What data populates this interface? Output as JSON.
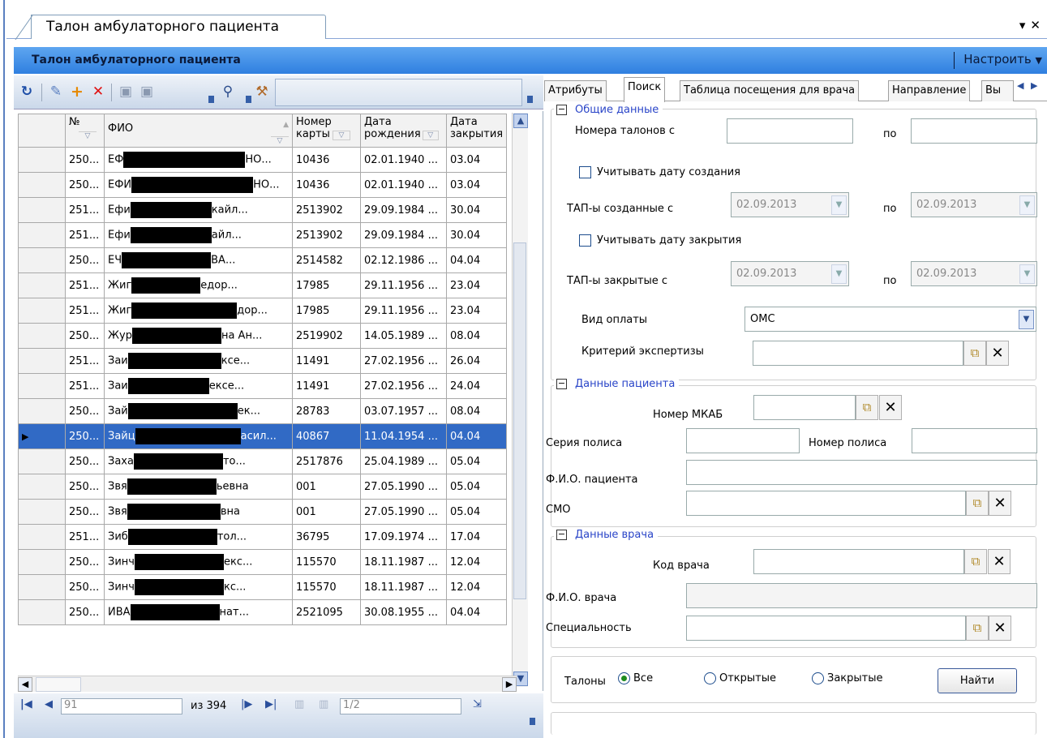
{
  "window": {
    "doc_tab": "Талон амбулаторного пациента",
    "header_title": "Талон амбулаторного пациента",
    "configure_label": "Настроить"
  },
  "toolbar": {
    "icons": [
      "refresh-icon",
      "edit-icon",
      "add-icon",
      "delete-icon",
      "save-icon",
      "save-all-icon",
      "binoculars-icon",
      "tools-icon"
    ]
  },
  "grid": {
    "columns": [
      "№",
      "ФИО",
      "Номер карты",
      "Дата рождения",
      "Дата закрытия"
    ],
    "col_no": "№",
    "col_fio": "ФИО",
    "col_card_1": "Номер",
    "col_card_2": "карты",
    "col_birth_1": "Дата",
    "col_birth_2": "рождения",
    "col_close_1": "Дата",
    "col_close_2": "закрытия",
    "rows": [
      {
        "no": "250...",
        "fio_a": "ЕФ",
        "fio_b": "НО...",
        "card": "10436",
        "birth": "02.01.1940 ...",
        "close": "03.04"
      },
      {
        "no": "250...",
        "fio_a": "ЕФИ",
        "fio_b": "НО...",
        "card": "10436",
        "birth": "02.01.1940 ...",
        "close": "03.04"
      },
      {
        "no": "251...",
        "fio_a": "Ефи",
        "fio_b": "кайл...",
        "card": "2513902",
        "birth": "29.09.1984 ...",
        "close": "30.04"
      },
      {
        "no": "251...",
        "fio_a": "Ефи",
        "fio_b": "айл...",
        "card": "2513902",
        "birth": "29.09.1984 ...",
        "close": "30.04"
      },
      {
        "no": "250...",
        "fio_a": "ЕЧ",
        "fio_b": "ВА...",
        "card": "2514582",
        "birth": "02.12.1986 ...",
        "close": "04.04"
      },
      {
        "no": "251...",
        "fio_a": "Жиг",
        "fio_b": "едор...",
        "card": "17985",
        "birth": "29.11.1956 ...",
        "close": "23.04"
      },
      {
        "no": "251...",
        "fio_a": "Жиг",
        "fio_b": "дор...",
        "card": "17985",
        "birth": "29.11.1956 ...",
        "close": "23.04"
      },
      {
        "no": "250...",
        "fio_a": "Жур",
        "fio_b": "на Ан...",
        "card": "2519902",
        "birth": "14.05.1989 ...",
        "close": "08.04"
      },
      {
        "no": "251...",
        "fio_a": "Заи",
        "fio_b": "ксе...",
        "card": "11491",
        "birth": "27.02.1956 ...",
        "close": "26.04"
      },
      {
        "no": "251...",
        "fio_a": "Заи",
        "fio_b": "ексе...",
        "card": "11491",
        "birth": "27.02.1956 ...",
        "close": "24.04"
      },
      {
        "no": "250...",
        "fio_a": "Зай",
        "fio_b": "ек...",
        "card": "28783",
        "birth": "03.07.1957 ...",
        "close": "08.04"
      },
      {
        "no": "250...",
        "fio_a": "Зайц",
        "fio_b": "асил...",
        "card": "40867",
        "birth": "11.04.1954 ...",
        "close": "04.04",
        "selected": true
      },
      {
        "no": "250...",
        "fio_a": "Заха",
        "fio_b": "то...",
        "card": "2517876",
        "birth": "25.04.1989 ...",
        "close": "05.04"
      },
      {
        "no": "250...",
        "fio_a": "Звя",
        "fio_b": "ьевна",
        "card": "001",
        "birth": "27.05.1990 ...",
        "close": "05.04"
      },
      {
        "no": "250...",
        "fio_a": "Звя",
        "fio_b": "вна",
        "card": "001",
        "birth": "27.05.1990 ...",
        "close": "05.04"
      },
      {
        "no": "251...",
        "fio_a": "Зиб",
        "fio_b": "тол...",
        "card": "36795",
        "birth": "17.09.1974 ...",
        "close": "17.04"
      },
      {
        "no": "250...",
        "fio_a": "Зинч",
        "fio_b": "екс...",
        "card": "115570",
        "birth": "18.11.1987 ...",
        "close": "12.04"
      },
      {
        "no": "250...",
        "fio_a": "Зинч",
        "fio_b": "кс...",
        "card": "115570",
        "birth": "18.11.1987 ...",
        "close": "12.04"
      },
      {
        "no": "250...",
        "fio_a": "ИВА",
        "fio_b": "нат...",
        "card": "2521095",
        "birth": "30.08.1955 ...",
        "close": "04.04"
      }
    ]
  },
  "pager": {
    "current": "91",
    "of_total": "из 394",
    "page": "1/2"
  },
  "tabs": [
    "Атрибуты",
    "Поиск",
    "Таблица посещения для врача",
    "Направление",
    "Вы"
  ],
  "active_tab": "Поиск",
  "search": {
    "general_title": "Общие данные",
    "ticket_numbers_from": "Номера талонов с",
    "to": "по",
    "use_create_date": "Учитывать дату создания",
    "created_from": "ТАП-ы созданные с",
    "created_date_from": "02.09.2013",
    "created_date_to": "02.09.2013",
    "use_close_date": "Учитывать дату закрытия",
    "closed_from": "ТАП-ы закрытые с",
    "closed_date_from": "02.09.2013",
    "closed_date_to": "02.09.2013",
    "payment_label": "Вид оплаты",
    "payment_value": "ОМС",
    "expertise_label": "Критерий экспертизы",
    "patient_title": "Данные пациента",
    "mkab_label": "Номер МКАБ",
    "policy_series": "Серия полиса",
    "policy_number": "Номер полиса",
    "patient_name": "Ф.И.О. пациента",
    "smo": "СМО",
    "doctor_title": "Данные врача",
    "doctor_code": "Код врача",
    "doctor_name": "Ф.И.О. врача",
    "speciality": "Специальность",
    "tickets_label": "Талоны",
    "radio_all": "Все",
    "radio_open": "Открытые",
    "radio_closed": "Закрытые",
    "find_button": "Найти"
  }
}
